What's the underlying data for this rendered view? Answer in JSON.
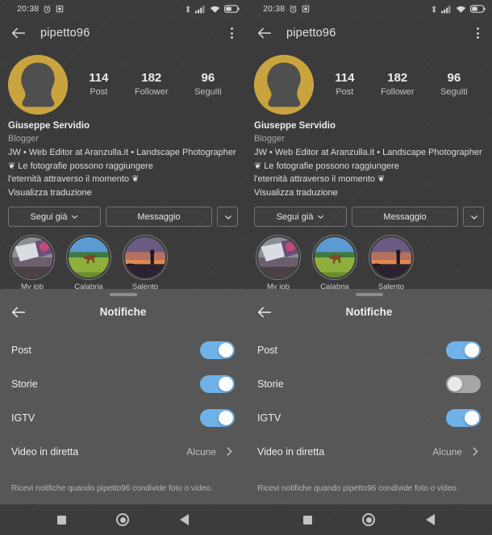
{
  "status_bar": {
    "time": "20:38",
    "left_icons": [
      "alarm-icon",
      "screenshot-icon"
    ],
    "right_icons": [
      "bluetooth-icon",
      "signal-icon",
      "wifi-icon",
      "battery-icon"
    ]
  },
  "app_bar": {
    "back_icon": "back-arrow-icon",
    "title": "pipetto96",
    "overflow_icon": "kebab-menu-icon"
  },
  "profile": {
    "avatar_alt": "profile-avatar",
    "stats": [
      {
        "value": "114",
        "label": "Post"
      },
      {
        "value": "182",
        "label": "Follower"
      },
      {
        "value": "96",
        "label": "Seguiti"
      }
    ],
    "name": "Giuseppe Servidio",
    "category": "Blogger",
    "bio_line1": "JW • Web Editor at Aranzulla.it • Landscape Photographer",
    "bio_line2": "❦ Le fotografie possono raggiungere",
    "bio_line3": "l'eternità attraverso il momento ❦",
    "translate_link": "Visualizza traduzione",
    "buttons": {
      "follow": "Segui già",
      "message": "Messaggio",
      "more_icon": "chevron-down-icon",
      "follow_icon": "chevron-down-icon"
    },
    "highlights": [
      {
        "label": "My job",
        "thumb": "desk-laptop-thumb"
      },
      {
        "label": "Calabria",
        "thumb": "field-horse-thumb"
      },
      {
        "label": "Salento",
        "thumb": "sunset-thumb"
      }
    ]
  },
  "sheet_left": {
    "back_icon": "back-arrow-icon",
    "title": "Notifiche",
    "rows": [
      {
        "label": "Post",
        "type": "toggle",
        "on": true
      },
      {
        "label": "Storie",
        "type": "toggle",
        "on": true
      },
      {
        "label": "IGTV",
        "type": "toggle",
        "on": true
      },
      {
        "label": "Video in diretta",
        "type": "link",
        "value": "Alcune",
        "icon": "chevron-right-icon"
      }
    ],
    "note": "Ricevi notifiche quando pipetto96 condivide foto o video."
  },
  "sheet_right": {
    "back_icon": "back-arrow-icon",
    "title": "Notifiche",
    "rows": [
      {
        "label": "Post",
        "type": "toggle",
        "on": true
      },
      {
        "label": "Storie",
        "type": "toggle",
        "on": false
      },
      {
        "label": "IGTV",
        "type": "toggle",
        "on": true
      },
      {
        "label": "Video in diretta",
        "type": "link",
        "value": "Alcune",
        "icon": "chevron-right-icon"
      }
    ],
    "note": "Ricevi notifiche quando pipetto96 condivide foto o video."
  },
  "nav_bar": {
    "recents_icon": "square-recents-icon",
    "home_icon": "circle-home-icon",
    "back_icon": "triangle-back-icon"
  },
  "colors": {
    "background": "#555555",
    "toggle_on": "#6fb2e8",
    "toggle_off": "#a6a6a6",
    "avatar_gold": "#c9a33e",
    "bar": "#3c3c3c"
  }
}
